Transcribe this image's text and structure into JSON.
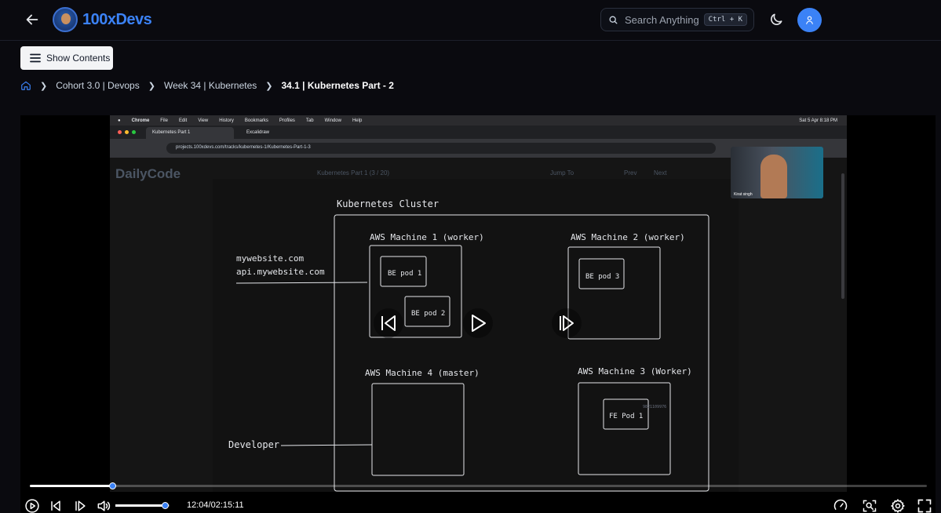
{
  "header": {
    "brand": "100xDevs",
    "search_placeholder": "Search Anything",
    "search_shortcut": "Ctrl + K"
  },
  "toolbar": {
    "show_contents_label": "Show Contents"
  },
  "breadcrumb": {
    "items": [
      "Cohort 3.0 | Devops",
      "Week 34 | Kubernetes",
      "34.1 | Kubernetes Part - 2"
    ]
  },
  "video": {
    "progress": 0.092,
    "volume": 0.92,
    "time_display": "12:04/02:15:11",
    "mac_menu": {
      "items": [
        "Chrome",
        "File",
        "Edit",
        "View",
        "History",
        "Bookmarks",
        "Profiles",
        "Tab",
        "Window",
        "Help"
      ],
      "clock": "Sat 5 Apr  8:18 PM"
    },
    "browser": {
      "tab1": "Kubernetes Part 1",
      "tab2": "Excalidraw",
      "url": "projects.100xdevs.com/tracks/kubernetes-1/Kubernetes-Part-1-3"
    },
    "page": {
      "logo": "DailyCode",
      "title": "Kubernetes Part 1 (3 / 20)",
      "jump": "Jump To",
      "prev": "Prev",
      "next": "Next"
    },
    "webcam_name": "Kirat singh",
    "board": {
      "cluster_title": "Kubernetes Cluster",
      "machine1": "AWS Machine 1 (worker)",
      "machine2": "AWS Machine 2 (worker)",
      "machine3": "AWS Machine 3 (Worker)",
      "machine4": "AWS Machine 4 (master)",
      "pod1": "BE pod 1",
      "pod2": "BE pod 2",
      "pod3": "BE pod 3",
      "fe_pod": "FE Pod 1",
      "domain1": "mywebsite.com",
      "domain2": "api.mywebsite.com",
      "developer": "Developer",
      "watermark": "9821109976"
    }
  }
}
